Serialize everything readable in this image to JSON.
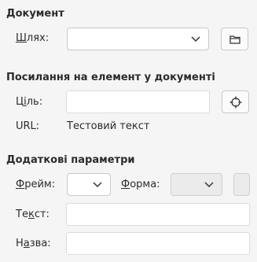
{
  "document": {
    "title": "Документ",
    "path_label_pre": "",
    "path_label_mnemonic": "Ш",
    "path_label_post": "лях:",
    "path_value": "",
    "open_file_icon": "folder-icon"
  },
  "target": {
    "title": "Посилання на елемент у документі",
    "target_label_pre": "Ц",
    "target_label_mnemonic": "і",
    "target_label_post": "ль:",
    "target_value": "",
    "target_icon": "crosshair-icon",
    "url_label": "URL:",
    "url_value": "Тестовий текст"
  },
  "extra": {
    "title": "Додаткові параметри",
    "frame_label_mnemonic": "Ф",
    "frame_label_post": "рейм:",
    "frame_value": "",
    "form_label_pre": "",
    "form_label_mnemonic": "Ф",
    "form_label_post": "орма:",
    "form_value": "",
    "text_label_pre": "Те",
    "text_label_mnemonic": "к",
    "text_label_post": "ст:",
    "text_value": "",
    "name_label_pre": "Н",
    "name_label_mnemonic": "а",
    "name_label_post": "зва:",
    "name_value": ""
  }
}
